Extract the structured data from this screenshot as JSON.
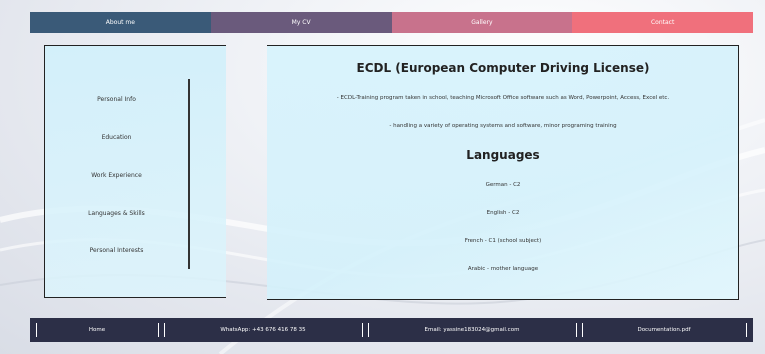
{
  "colors": {
    "nav_about": "#3a5a78",
    "nav_cv": "#6a5a7c",
    "nav_gallery": "#c8728c",
    "nav_contact": "#f0707c",
    "footer_bg": "#2c2f47"
  },
  "topnav": {
    "items": [
      {
        "label": "About me"
      },
      {
        "label": "My CV"
      },
      {
        "label": "Gallery"
      },
      {
        "label": "Contact"
      }
    ]
  },
  "sidebar": {
    "items": [
      {
        "label": "Personal Info"
      },
      {
        "label": "Education"
      },
      {
        "label": "Work Experience"
      },
      {
        "label": "Languages & Skills"
      },
      {
        "label": "Personal Interests"
      }
    ]
  },
  "main": {
    "section1_title": "ECDL (European Computer Driving License)",
    "section1_lines": [
      "- ECDL-Training program taken in school, teaching Microsoft Office software such as Word, Powerpoint, Access, Excel etc.",
      "- handling a variety of operating systems and software, minor programing training"
    ],
    "section2_title": "Languages",
    "languages": [
      "German - C2",
      "English - C2",
      "French - C1 (school subject)",
      "Arabic - mother language"
    ]
  },
  "footer": {
    "home": "Home",
    "whatsapp": "WhatsApp: +43 676 416 78 35",
    "email": "Email: yassine183024@gmail.com",
    "documentation": "Documentation.pdf"
  }
}
